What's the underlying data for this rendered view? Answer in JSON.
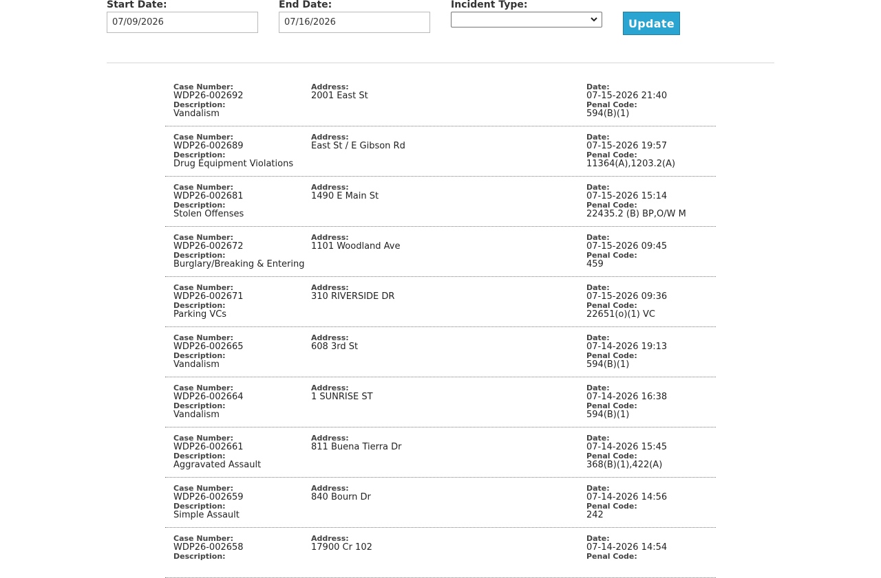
{
  "filters": {
    "start_label": "Start Date:",
    "start_value": "07/09/2026",
    "end_label": "End Date:",
    "end_value": "07/16/2026",
    "type_label": "Incident Type:",
    "type_value": "",
    "update_label": "Update"
  },
  "labels": {
    "case_number": "Case Number:",
    "description": "Description:",
    "address": "Address:",
    "date": "Date:",
    "penal_code": "Penal Code:"
  },
  "incidents": [
    {
      "case": "WDP26-002692",
      "description": "Vandalism",
      "address": "2001 East St",
      "date": "07-15-2026 21:40",
      "penal": "594(B)(1)"
    },
    {
      "case": "WDP26-002689",
      "description": "Drug Equipment Violations",
      "address": "East St / E Gibson Rd",
      "date": "07-15-2026 19:57",
      "penal": "11364(A),1203.2(A)"
    },
    {
      "case": "WDP26-002681",
      "description": "Stolen Offenses",
      "address": "1490 E Main St",
      "date": "07-15-2026 15:14",
      "penal": "22435.2 (B) BP,O/W M"
    },
    {
      "case": "WDP26-002672",
      "description": "Burglary/Breaking & Entering",
      "address": "1101 Woodland Ave",
      "date": "07-15-2026 09:45",
      "penal": "459"
    },
    {
      "case": "WDP26-002671",
      "description": "Parking VCs",
      "address": "310 RIVERSIDE DR",
      "date": "07-15-2026 09:36",
      "penal": "22651(o)(1) VC"
    },
    {
      "case": "WDP26-002665",
      "description": "Vandalism",
      "address": "608 3rd St",
      "date": "07-14-2026 19:13",
      "penal": "594(B)(1)"
    },
    {
      "case": "WDP26-002664",
      "description": "Vandalism",
      "address": "1 SUNRISE ST",
      "date": "07-14-2026 16:38",
      "penal": "594(B)(1)"
    },
    {
      "case": "WDP26-002661",
      "description": "Aggravated Assault",
      "address": "811 Buena Tierra Dr",
      "date": "07-14-2026 15:45",
      "penal": "368(B)(1),422(A)"
    },
    {
      "case": "WDP26-002659",
      "description": "Simple Assault",
      "address": "840 Bourn Dr",
      "date": "07-14-2026 14:56",
      "penal": "242"
    },
    {
      "case": "WDP26-002658",
      "description": "",
      "address": "17900 Cr 102",
      "date": "07-14-2026 14:54",
      "penal": ""
    }
  ]
}
